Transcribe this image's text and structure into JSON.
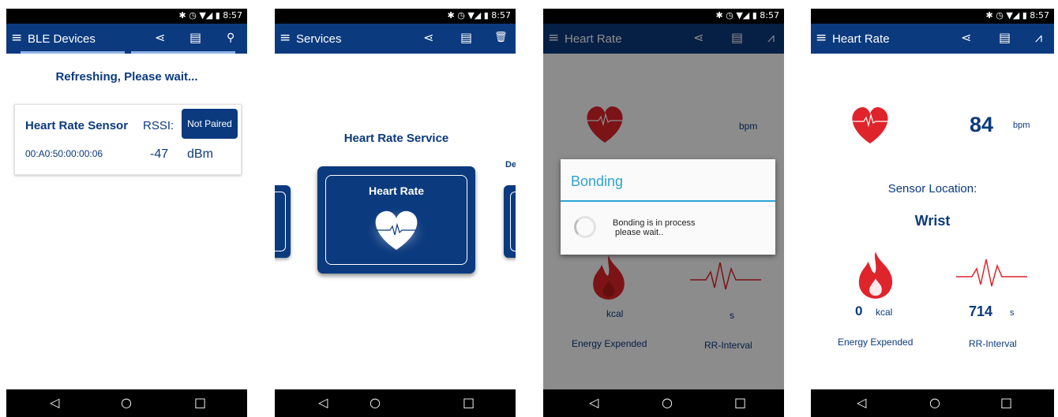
{
  "status_time": "8:57",
  "status_icons": "✱ ◷ ▼◢ ▮",
  "nav": {
    "back": "◁",
    "home": "○",
    "recent": "□"
  },
  "icons": {
    "menu": "≡",
    "share": "⋖",
    "report": "▤",
    "search": "⚲",
    "delete": "🗑",
    "graph": "⩘"
  },
  "screen1": {
    "title": "BLE Devices",
    "refresh_text": "Refreshing, Please wait...",
    "device": {
      "name": "Heart Rate Sensor",
      "rssi_label": "RSSI:",
      "pair_button": "Not Paired",
      "address": "00:A0:50:00:00:06",
      "rssi_value": "-47",
      "rssi_unit": "dBm"
    }
  },
  "screen2": {
    "title": "Services",
    "service_title": "Heart Rate Service",
    "card_label": "Heart Rate",
    "peek_text": "Dev"
  },
  "screen3": {
    "title": "Heart Rate",
    "bpm_unit": "bpm",
    "kcal_unit": "kcal",
    "s_unit": "s",
    "energy_label": "Energy Expended",
    "rr_label": "RR-Interval",
    "dialog_title": "Bonding",
    "dialog_message": "Bonding is in process\n please wait.."
  },
  "screen4": {
    "title": "Heart Rate",
    "bpm_value": "84",
    "bpm_unit": "bpm",
    "sensor_location_label": "Sensor Location:",
    "sensor_location_value": "Wrist",
    "kcal_value": "0",
    "kcal_unit": "kcal",
    "rr_value": "714",
    "rr_unit": "s",
    "energy_label": "Energy Expended",
    "rr_label": "RR-Interval"
  }
}
